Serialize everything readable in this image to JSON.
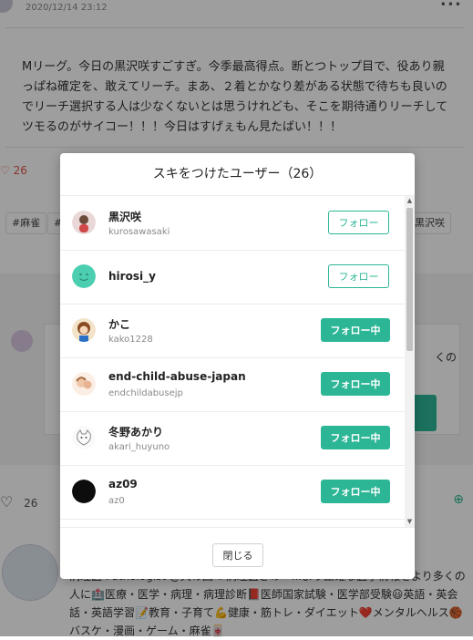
{
  "background": {
    "date": "2020/12/14 23:12",
    "menu_glyph": "•••",
    "quote": "Mリーグ。今日の黒沢咲すごすぎ。今季最高得点。断とつトップ目で、役あり親っぱね確定を、敢えてリーチ。まあ、２着とかなり差がある状態で待ちも良いのでリーチ選択する人は少なくないとは思うけれども、そこを期待通りリーチしてツモるのがサイコー！！！今日はすげぇもん見たばい！！！",
    "like_count_top": "26",
    "tags": [
      "#麻雀",
      "#",
      "黒沢咲"
    ],
    "card_text": "くの",
    "like_count_bottom": "26",
    "profile_text": "病理医 Pathologist @大の国 #病理医さの　...より正確な医学情報をより多くの人に🏥医療・医学・病理・病理診断📕医師国家試験・医学部受験😃英語・英会話・英語学習📝教育・子育て💪健康・筋トレ・ダイエット❤️メンタルヘルス🏀バスケ・漫画・ゲーム・麻雀🀄"
  },
  "modal": {
    "title": "スキをつけたユーザー（26）",
    "users": [
      {
        "name": "黒沢咲",
        "id": "kurosawasaki",
        "button": "フォロー",
        "following": false,
        "avatar_color": "#e8d6d6"
      },
      {
        "name": "hirosi_y",
        "id": "",
        "button": "フォロー",
        "following": false,
        "avatar_color": "#4ccfb1"
      },
      {
        "name": "かこ",
        "id": "kako1228",
        "button": "フォロー中",
        "following": true,
        "avatar_color": "#c77a3b"
      },
      {
        "name": "end-child-abuse-japan",
        "id": "endchildabusejp",
        "button": "フォロー中",
        "following": true,
        "avatar_color": "#f0c6a8"
      },
      {
        "name": "冬野あかり",
        "id": "akari_huyuno",
        "button": "フォロー中",
        "following": true,
        "avatar_color": "#f2f2f2"
      },
      {
        "name": "az09",
        "id": "az0",
        "button": "フォロー中",
        "following": true,
        "avatar_color": "#111111"
      }
    ],
    "close_label": "閉じる"
  },
  "colors": {
    "accent": "#2cb696",
    "like": "#e0534a"
  }
}
